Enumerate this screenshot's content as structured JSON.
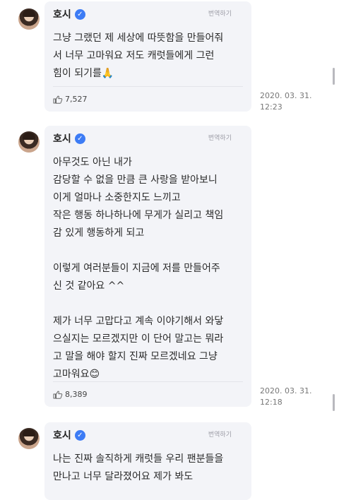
{
  "messages": [
    {
      "name": "호시",
      "translate_label": "번역하기",
      "text": "그냥 그랬던 제 세상에 따뜻함을 만들어줘\n서 너무 고마워요 저도 캐럿들에게 그런\n힘이 되기를🙏",
      "likes": "7,527",
      "date": "2020. 03. 31.",
      "time": "12:23"
    },
    {
      "name": "호시",
      "translate_label": "번역하기",
      "text": "아무것도 아닌 내가\n감당할 수 없을 만큼 큰 사랑을 받아보니\n이게 얼마나 소중한지도 느끼고\n작은 행동 하나하나에 무게가 실리고 책임\n감 있게 행동하게 되고\n\n이렇게 여러분들이 지금에 저를 만들어주\n신 것 같아요 ^^\n\n제가 너무 고맙다고 계속 이야기해서 와닿\n으실지는 모르겠지만 이 단어 말고는 뭐라\n고 말을 해야 할지 진짜 모르겠네요 그냥\n고마워요😊",
      "likes": "8,389",
      "date": "2020. 03. 31.",
      "time": "12:18"
    },
    {
      "name": "호시",
      "translate_label": "번역하기",
      "text": "나는 진짜 솔직하게 캐럿들 우리 팬분들을\n만나고 너무 달라졌어요 제가 봐도"
    }
  ],
  "icons": {
    "verified": "verified-badge-icon",
    "like": "thumbs-up-icon"
  },
  "colors": {
    "bubble": "#f3f4f8",
    "verified": "#3d7cf5"
  }
}
